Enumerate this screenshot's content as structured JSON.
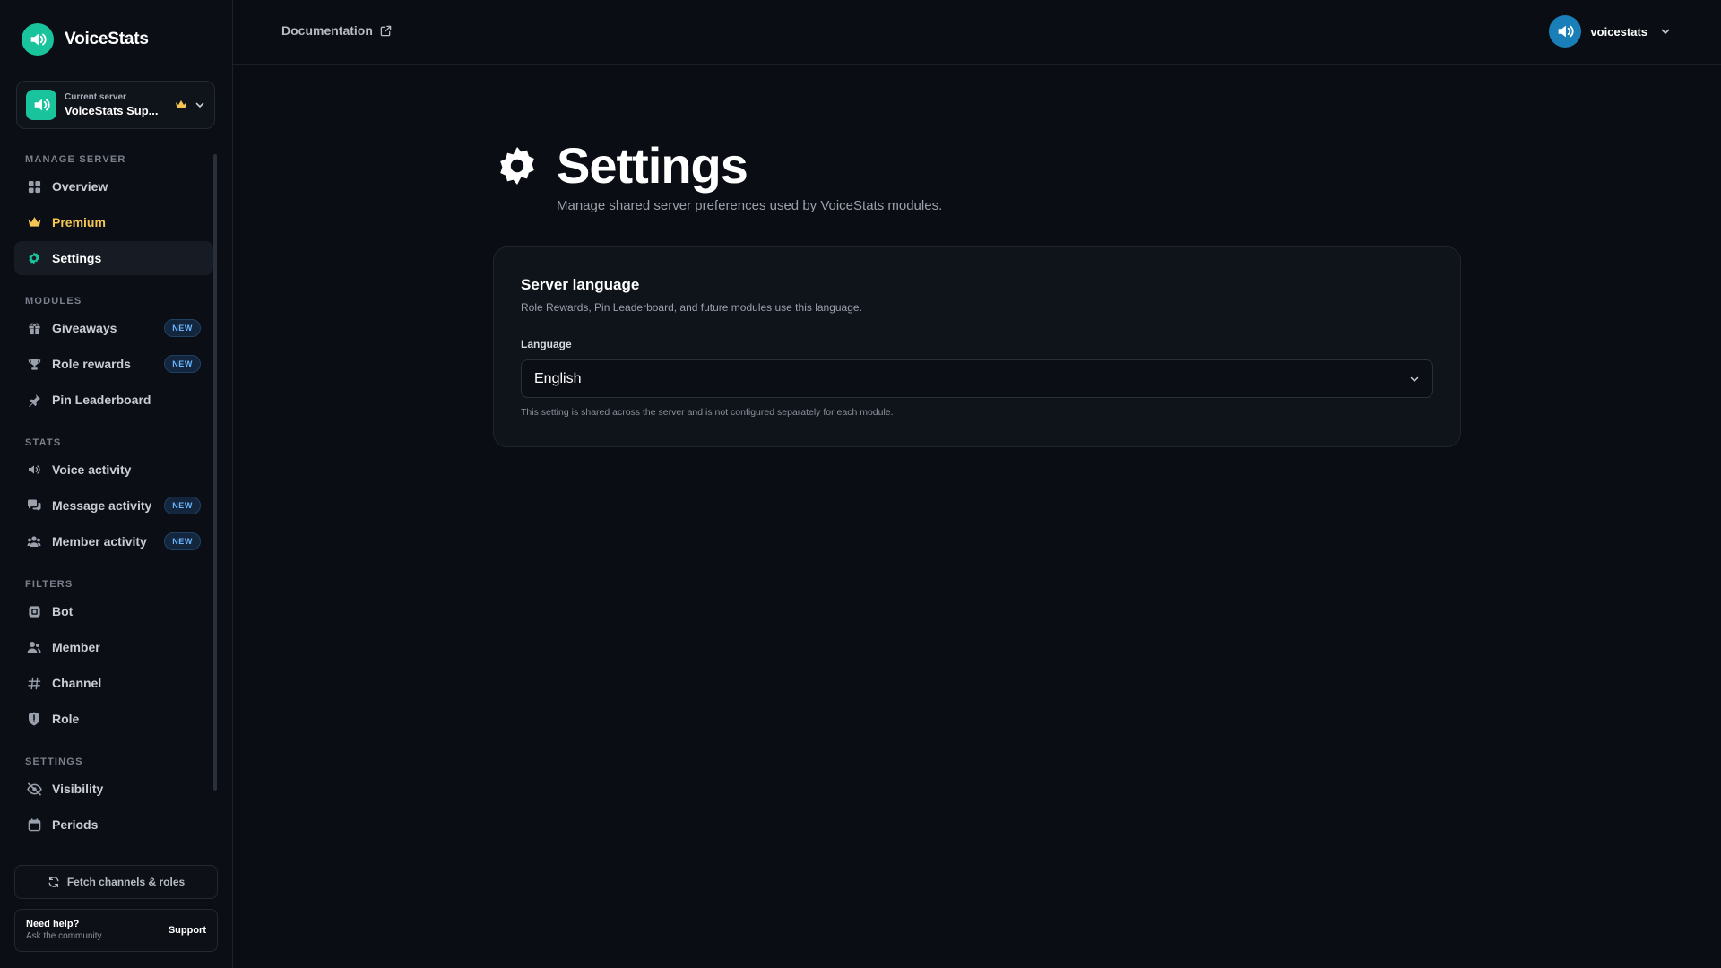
{
  "brand": {
    "name": "VoiceStats"
  },
  "server": {
    "kicker": "Current server",
    "name": "VoiceStats Sup..."
  },
  "sections": {
    "manage": "MANAGE SERVER",
    "modules": "MODULES",
    "stats": "STATS",
    "filters": "FILTERS",
    "settings": "SETTINGS"
  },
  "nav": {
    "overview": "Overview",
    "premium": "Premium",
    "settings": "Settings",
    "giveaways": "Giveaways",
    "role_rewards": "Role rewards",
    "pin_leaderboard": "Pin Leaderboard",
    "voice_activity": "Voice activity",
    "message_activity": "Message activity",
    "member_activity": "Member activity",
    "bot": "Bot",
    "member": "Member",
    "channel": "Channel",
    "role": "Role",
    "visibility": "Visibility",
    "periods": "Periods",
    "badge_new": "NEW",
    "active_item": "Settings"
  },
  "footer": {
    "fetch_label": "Fetch channels & roles",
    "help_title": "Need help?",
    "help_sub": "Ask the community.",
    "support_label": "Support"
  },
  "topbar": {
    "doc_label": "Documentation",
    "username": "voicestats"
  },
  "page": {
    "title": "Settings",
    "subtitle": "Manage shared server preferences used by VoiceStats modules."
  },
  "card": {
    "title": "Server language",
    "description": "Role Rewards, Pin Leaderboard, and future modules use this language.",
    "field_label": "Language",
    "selected_value": "English",
    "hint": "This setting is shared across the server and is not configured separately for each module."
  },
  "colors": {
    "accent": "#19c39b",
    "premium": "#f3c653",
    "badge": "#6cb6ff",
    "background": "#0a0d13"
  },
  "icons": {
    "brand": "speaker-icon",
    "overview": "grid-icon",
    "premium": "crown-icon",
    "settings": "gear-icon",
    "giveaways": "gift-icon",
    "role_rewards": "trophy-icon",
    "pin_leaderboard": "pin-icon",
    "voice_activity": "speaker-icon",
    "message_activity": "chat-icon",
    "member_activity": "users-icon",
    "bot": "bot-icon",
    "member": "user-icon",
    "channel": "hash-icon",
    "role": "shield-icon",
    "visibility": "eye-off-icon",
    "periods": "calendar-icon"
  }
}
